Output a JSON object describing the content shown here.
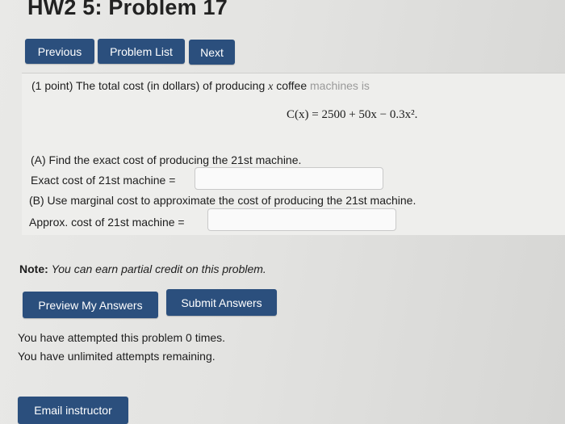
{
  "header": {
    "title": "HW2 5: Problem 17"
  },
  "nav": {
    "previous": "Previous",
    "problem_list": "Problem List",
    "next": "Next"
  },
  "problem": {
    "points": "(1 point)",
    "intro_text": "The total cost (in dollars) of producing",
    "variable": "x",
    "intro_tail": "coffee",
    "intro_faded": "machines is",
    "formula": "C(x) = 2500 + 50x − 0.3x².",
    "part_a": "(A) Find the exact cost of producing the 21st machine.",
    "part_a_label": "Exact cost of 21st machine =",
    "part_a_value": "",
    "part_b": "(B) Use marginal cost to approximate the cost of producing the 21st machine.",
    "part_b_label": "Approx. cost of 21st machine =",
    "part_b_value": ""
  },
  "note": {
    "label": "Note:",
    "text": "You can earn partial credit on this problem."
  },
  "actions": {
    "preview": "Preview My Answers",
    "submit": "Submit Answers"
  },
  "status": {
    "attempts": "You have attempted this problem 0 times.",
    "remaining": "You have unlimited attempts remaining."
  },
  "footer": {
    "email": "Email instructor"
  },
  "colors": {
    "button_bg": "#2b4f7d",
    "button_text": "#ffffff"
  }
}
